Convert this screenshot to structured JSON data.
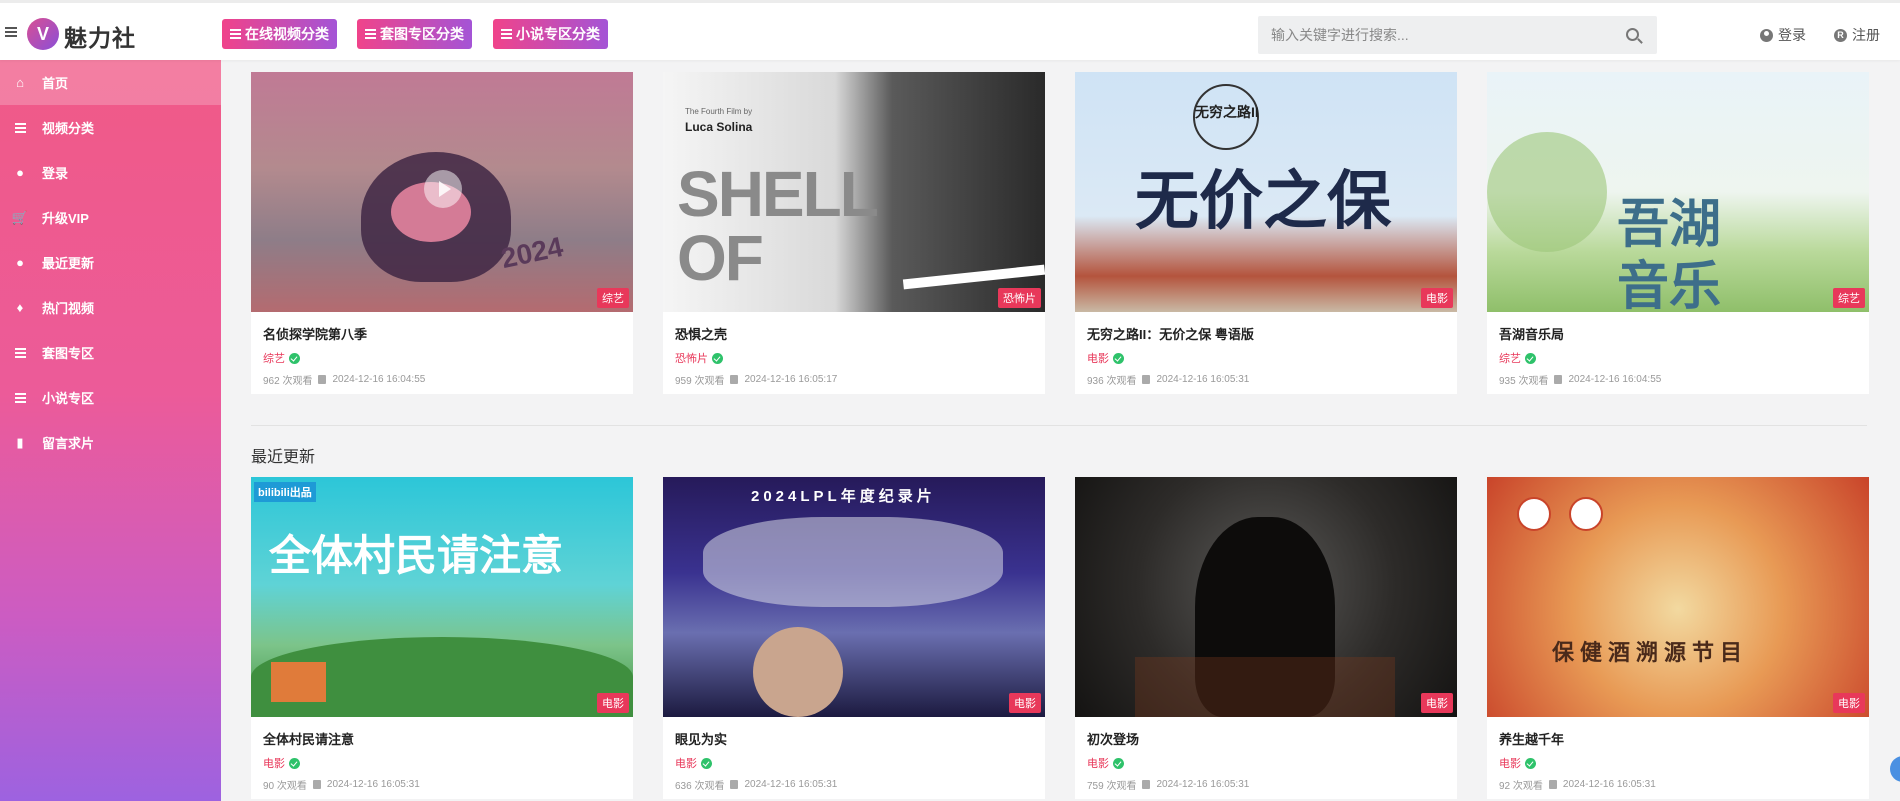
{
  "brand": {
    "logo_letter": "V",
    "name": "魅力社"
  },
  "header": {
    "categories": [
      {
        "label": "在线视频分类"
      },
      {
        "label": "套图专区分类"
      },
      {
        "label": "小说专区分类"
      }
    ],
    "search": {
      "placeholder": "输入关键字进行搜索..."
    },
    "login_label": "登录",
    "register_label": "注册",
    "register_icon_letter": "R"
  },
  "sidebar": {
    "items": [
      {
        "label": "首页",
        "icon": "home-icon",
        "glyph": "⌂"
      },
      {
        "label": "视频分类",
        "icon": "list-icon"
      },
      {
        "label": "登录",
        "icon": "user-circle-icon",
        "glyph": "●"
      },
      {
        "label": "升级VIP",
        "icon": "cart-icon",
        "glyph": "🛒"
      },
      {
        "label": "最近更新",
        "icon": "user-icon",
        "glyph": "●"
      },
      {
        "label": "热门视频",
        "icon": "fire-icon",
        "glyph": "♦"
      },
      {
        "label": "套图专区",
        "icon": "list-icon"
      },
      {
        "label": "小说专区",
        "icon": "list-icon"
      },
      {
        "label": "留言求片",
        "icon": "clipboard-icon",
        "glyph": "▮"
      }
    ]
  },
  "section_title": "最近更新",
  "row1": [
    {
      "title": "名侦探学院第八季",
      "category": "综艺",
      "tag": "综艺",
      "views": "962 次观看",
      "date": "2024-12-16 16:04:55",
      "overlay": "2024"
    },
    {
      "title": "恐惧之壳",
      "category": "恐怖片",
      "tag": "恐怖片",
      "views": "959 次观看",
      "date": "2024-12-16 16:05:17",
      "overlay": "SHELL OF",
      "overlay2": "Luca Solina",
      "overlay3": "The Fourth Film by"
    },
    {
      "title": "无穷之路II：无价之保 粤语版",
      "category": "电影",
      "tag": "电影",
      "views": "936 次观看",
      "date": "2024-12-16 16:05:31",
      "overlay": "无价之保",
      "overlay2": "无穷之路II"
    },
    {
      "title": "吾湖音乐局",
      "category": "综艺",
      "tag": "综艺",
      "views": "935 次观看",
      "date": "2024-12-16 16:04:55",
      "overlay": "吾湖",
      "overlay2": "音乐"
    }
  ],
  "row2": [
    {
      "title": "全体村民请注意",
      "category": "电影",
      "tag": "电影",
      "views": "90 次观看",
      "date": "2024-12-16 16:05:31",
      "overlay": "全体村民请注意",
      "overlay2": "bilibili出品"
    },
    {
      "title": "眼见为实",
      "category": "电影",
      "tag": "电影",
      "views": "636 次观看",
      "date": "2024-12-16 16:05:31",
      "overlay": "2024LPL年度纪录片"
    },
    {
      "title": "初次登场",
      "category": "电影",
      "tag": "电影",
      "views": "759 次观看",
      "date": "2024-12-16 16:05:31"
    },
    {
      "title": "养生越千年",
      "category": "电影",
      "tag": "电影",
      "views": "92 次观看",
      "date": "2024-12-16 16:05:31",
      "overlay": "保健酒溯源节目"
    }
  ],
  "colors": {
    "accent": "#e8385a",
    "sidebar_top": "#f05a87",
    "sidebar_bottom": "#9d62e0",
    "verified": "#2ec26a"
  }
}
